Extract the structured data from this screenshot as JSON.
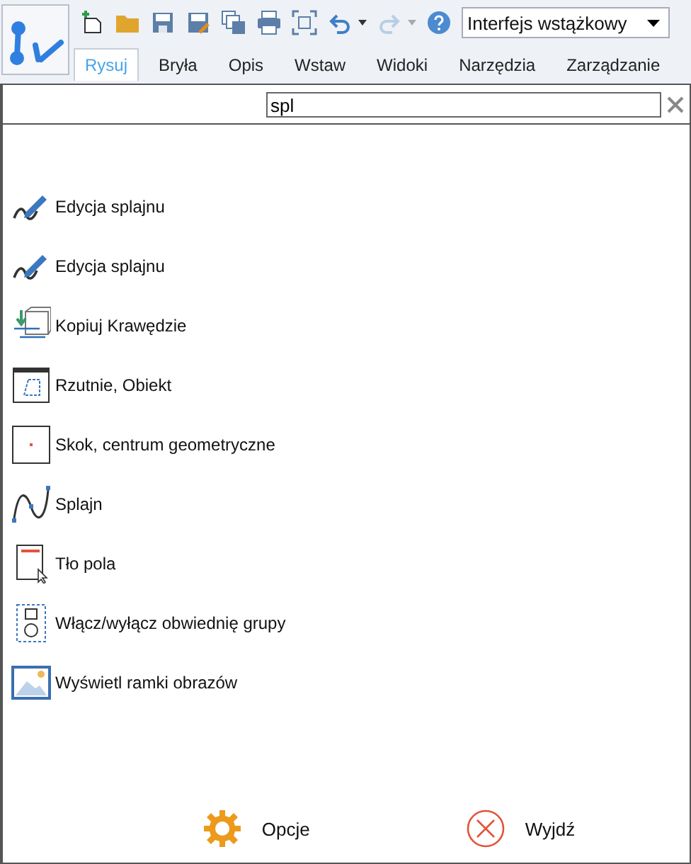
{
  "toolbar": {
    "redo": {
      "disabled": true
    },
    "interface_select": {
      "value": "Interfejs wstążkowy"
    }
  },
  "tabs": [
    {
      "label": "Rysuj",
      "selected": true
    },
    {
      "label": "Bryła",
      "selected": false
    },
    {
      "label": "Opis",
      "selected": false
    },
    {
      "label": "Wstaw",
      "selected": false
    },
    {
      "label": "Widoki",
      "selected": false
    },
    {
      "label": "Narzędzia",
      "selected": false
    },
    {
      "label": "Zarządzanie",
      "selected": false
    }
  ],
  "search": {
    "value": "spl"
  },
  "results": [
    {
      "label": "Edycja splajnu"
    },
    {
      "label": "Edycja splajnu"
    },
    {
      "label": "Kopiuj Krawędzie"
    },
    {
      "label": "Rzutnie, Obiekt"
    },
    {
      "label": "Skok, centrum geometryczne"
    },
    {
      "label": "Splajn"
    },
    {
      "label": "Tło pola"
    },
    {
      "label": "Włącz/wyłącz obwiednię grupy"
    },
    {
      "label": "Wyświetl ramki obrazów"
    }
  ],
  "footer": {
    "options": "Opcje",
    "exit": "Wyjdź"
  }
}
